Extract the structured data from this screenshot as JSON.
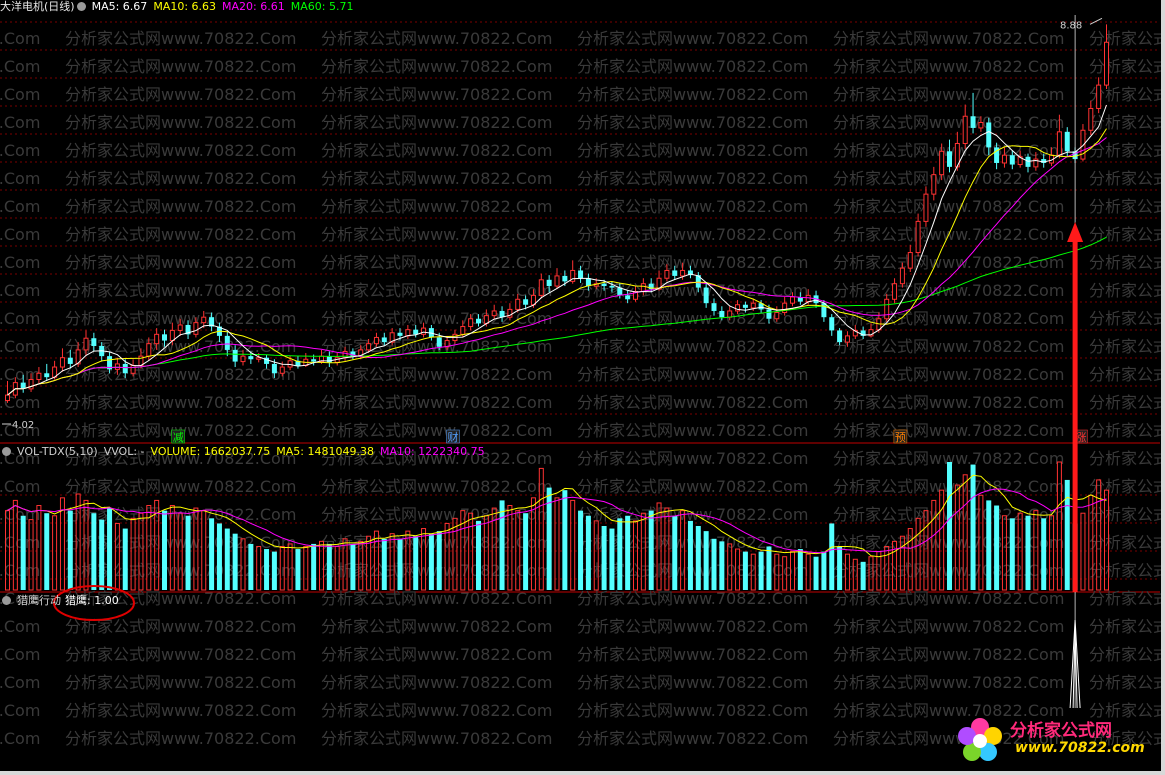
{
  "main_header": {
    "title": "大洋电机(日线)",
    "ma5": "MA5: 6.67",
    "ma10": "MA10: 6.63",
    "ma20": "MA20: 6.61",
    "ma60": "MA60: 5.71"
  },
  "vol_header": {
    "name": "VOL-TDX(5,10)",
    "vvol": "VVOL: -",
    "volume": "VOLUME: 1662037.75",
    "ma5": "MA5: 1481049.38",
    "ma10": "MA10: 1222340.75"
  },
  "ind_header": {
    "name": "猎鹰行动",
    "value": "猎鹰: 1.00"
  },
  "watermark": "分析家公式网www.70822.Com",
  "logo": {
    "brand": "分析家公式网",
    "url": "www.70822.com"
  },
  "colors": {
    "up": "#ff3232",
    "down": "#54ffff",
    "ma5": "#ffffff",
    "ma10": "#ffff00",
    "ma20": "#ff00ff",
    "ma60": "#00ff00",
    "grid": "#7a0000",
    "arrow": "#ff1a1a",
    "annotation_circle": "#e00000"
  },
  "chart_data": {
    "type": "candlestick",
    "price_labels": {
      "high": "8.88",
      "low": "4.02"
    },
    "price_range": [
      3.8,
      9.0
    ],
    "events": [
      {
        "label": "减",
        "bar": 22,
        "color": "#00ff00"
      },
      {
        "label": "财",
        "bar": 57,
        "color": "#54a0ff"
      },
      {
        "label": "预",
        "bar": 114,
        "color": "#ff8000"
      },
      {
        "label": "涨",
        "bar": 137,
        "color": "#ff3232"
      }
    ],
    "candles": [
      [
        4.05,
        4.12,
        4.3,
        4.02
      ],
      [
        4.12,
        4.28,
        4.35,
        4.08
      ],
      [
        4.28,
        4.2,
        4.38,
        4.15
      ],
      [
        4.2,
        4.32,
        4.4,
        4.16
      ],
      [
        4.32,
        4.4,
        4.48,
        4.26
      ],
      [
        4.4,
        4.35,
        4.52,
        4.3
      ],
      [
        4.35,
        4.48,
        4.56,
        4.32
      ],
      [
        4.48,
        4.6,
        4.72,
        4.42
      ],
      [
        4.6,
        4.52,
        4.7,
        4.46
      ],
      [
        4.52,
        4.7,
        4.8,
        4.48
      ],
      [
        4.7,
        4.85,
        4.95,
        4.62
      ],
      [
        4.85,
        4.75,
        4.92,
        4.68
      ],
      [
        4.75,
        4.62,
        4.8,
        4.55
      ],
      [
        4.62,
        4.45,
        4.68,
        4.4
      ],
      [
        4.45,
        4.52,
        4.6,
        4.38
      ],
      [
        4.52,
        4.4,
        4.58,
        4.34
      ],
      [
        4.4,
        4.5,
        4.58,
        4.36
      ],
      [
        4.5,
        4.62,
        4.72,
        4.46
      ],
      [
        4.62,
        4.78,
        4.86,
        4.56
      ],
      [
        4.78,
        4.9,
        4.98,
        4.7
      ],
      [
        4.9,
        4.82,
        4.96,
        4.74
      ],
      [
        4.82,
        4.95,
        5.05,
        4.76
      ],
      [
        4.95,
        5.02,
        5.1,
        4.88
      ],
      [
        5.02,
        4.9,
        5.08,
        4.84
      ],
      [
        4.9,
        5.05,
        5.12,
        4.86
      ],
      [
        5.05,
        5.12,
        5.2,
        4.98
      ],
      [
        5.12,
        5.0,
        5.18,
        4.94
      ],
      [
        5.0,
        4.88,
        5.05,
        4.8
      ],
      [
        4.88,
        4.7,
        4.94,
        4.62
      ],
      [
        4.7,
        4.55,
        4.76,
        4.48
      ],
      [
        4.55,
        4.62,
        4.7,
        4.5
      ],
      [
        4.62,
        4.58,
        4.68,
        4.52
      ],
      [
        4.58,
        4.6,
        4.66,
        4.54
      ],
      [
        4.6,
        4.52,
        4.64,
        4.46
      ],
      [
        4.52,
        4.4,
        4.58,
        4.34
      ],
      [
        4.4,
        4.48,
        4.55,
        4.36
      ],
      [
        4.48,
        4.56,
        4.62,
        4.44
      ],
      [
        4.56,
        4.5,
        4.62,
        4.46
      ],
      [
        4.5,
        4.58,
        4.66,
        4.48
      ],
      [
        4.58,
        4.55,
        4.64,
        4.5
      ],
      [
        4.55,
        4.62,
        4.7,
        4.52
      ],
      [
        4.62,
        4.54,
        4.68,
        4.48
      ],
      [
        4.54,
        4.6,
        4.66,
        4.5
      ],
      [
        4.6,
        4.68,
        4.74,
        4.56
      ],
      [
        4.68,
        4.62,
        4.72,
        4.58
      ],
      [
        4.62,
        4.7,
        4.76,
        4.58
      ],
      [
        4.7,
        4.78,
        4.84,
        4.66
      ],
      [
        4.78,
        4.86,
        4.92,
        4.74
      ],
      [
        4.86,
        4.8,
        4.92,
        4.76
      ],
      [
        4.8,
        4.92,
        4.98,
        4.76
      ],
      [
        4.92,
        4.88,
        4.98,
        4.82
      ],
      [
        4.88,
        4.96,
        5.02,
        4.84
      ],
      [
        4.96,
        4.9,
        5.02,
        4.86
      ],
      [
        4.9,
        4.98,
        5.05,
        4.86
      ],
      [
        4.98,
        4.86,
        5.02,
        4.82
      ],
      [
        4.86,
        4.74,
        4.92,
        4.7
      ],
      [
        4.74,
        4.82,
        4.88,
        4.7
      ],
      [
        4.82,
        4.9,
        4.96,
        4.78
      ],
      [
        4.9,
        5.0,
        5.08,
        4.86
      ],
      [
        5.0,
        5.1,
        5.16,
        4.95
      ],
      [
        5.1,
        5.04,
        5.16,
        5.0
      ],
      [
        5.04,
        5.14,
        5.22,
        5.0
      ],
      [
        5.14,
        5.2,
        5.28,
        5.1
      ],
      [
        5.2,
        5.12,
        5.26,
        5.06
      ],
      [
        5.12,
        5.22,
        5.3,
        5.08
      ],
      [
        5.22,
        5.35,
        5.42,
        5.18
      ],
      [
        5.35,
        5.28,
        5.4,
        5.22
      ],
      [
        5.28,
        5.4,
        5.48,
        5.24
      ],
      [
        5.4,
        5.6,
        5.68,
        5.36
      ],
      [
        5.6,
        5.52,
        5.66,
        5.44
      ],
      [
        5.52,
        5.65,
        5.75,
        5.48
      ],
      [
        5.65,
        5.58,
        5.72,
        5.52
      ],
      [
        5.58,
        5.72,
        5.85,
        5.55
      ],
      [
        5.72,
        5.62,
        5.78,
        5.56
      ],
      [
        5.62,
        5.52,
        5.68,
        5.46
      ],
      [
        5.52,
        5.55,
        5.62,
        5.48
      ],
      [
        5.55,
        5.52,
        5.6,
        5.46
      ],
      [
        5.52,
        5.5,
        5.58,
        5.44
      ],
      [
        5.5,
        5.4,
        5.56,
        5.36
      ],
      [
        5.4,
        5.35,
        5.46,
        5.3
      ],
      [
        5.35,
        5.45,
        5.52,
        5.32
      ],
      [
        5.45,
        5.55,
        5.62,
        5.4
      ],
      [
        5.55,
        5.48,
        5.62,
        5.44
      ],
      [
        5.48,
        5.62,
        5.72,
        5.46
      ],
      [
        5.62,
        5.72,
        5.8,
        5.58
      ],
      [
        5.72,
        5.65,
        5.78,
        5.6
      ],
      [
        5.65,
        5.72,
        5.82,
        5.6
      ],
      [
        5.72,
        5.66,
        5.78,
        5.62
      ],
      [
        5.66,
        5.5,
        5.7,
        5.44
      ],
      [
        5.5,
        5.3,
        5.56,
        5.24
      ],
      [
        5.3,
        5.2,
        5.36,
        5.14
      ],
      [
        5.2,
        5.12,
        5.26,
        5.08
      ],
      [
        5.12,
        5.2,
        5.26,
        5.08
      ],
      [
        5.2,
        5.28,
        5.34,
        5.16
      ],
      [
        5.28,
        5.24,
        5.32,
        5.18
      ],
      [
        5.24,
        5.3,
        5.36,
        5.2
      ],
      [
        5.3,
        5.22,
        5.34,
        5.18
      ],
      [
        5.22,
        5.1,
        5.28,
        5.04
      ],
      [
        5.1,
        5.18,
        5.26,
        5.06
      ],
      [
        5.18,
        5.3,
        5.38,
        5.14
      ],
      [
        5.3,
        5.38,
        5.44,
        5.26
      ],
      [
        5.38,
        5.32,
        5.44,
        5.28
      ],
      [
        5.32,
        5.4,
        5.48,
        5.28
      ],
      [
        5.4,
        5.3,
        5.46,
        5.24
      ],
      [
        5.3,
        5.12,
        5.34,
        5.06
      ],
      [
        5.12,
        4.95,
        5.16,
        4.88
      ],
      [
        4.95,
        4.8,
        4.98,
        4.76
      ],
      [
        4.8,
        4.88,
        4.94,
        4.74
      ],
      [
        4.88,
        4.95,
        5.02,
        4.84
      ],
      [
        4.95,
        4.88,
        5.0,
        4.84
      ],
      [
        4.88,
        4.96,
        5.04,
        4.86
      ],
      [
        4.96,
        5.1,
        5.18,
        4.92
      ],
      [
        5.1,
        5.35,
        5.42,
        5.06
      ],
      [
        5.35,
        5.55,
        5.62,
        5.3
      ],
      [
        5.55,
        5.75,
        5.82,
        5.5
      ],
      [
        5.75,
        5.95,
        6.05,
        5.7
      ],
      [
        5.95,
        6.35,
        6.45,
        5.9
      ],
      [
        6.35,
        6.7,
        6.8,
        6.28
      ],
      [
        6.7,
        6.95,
        7.05,
        6.62
      ],
      [
        6.95,
        7.25,
        7.35,
        6.88
      ],
      [
        7.25,
        7.05,
        7.4,
        6.98
      ],
      [
        7.05,
        7.35,
        7.5,
        7.0
      ],
      [
        7.35,
        7.7,
        7.85,
        7.28
      ],
      [
        7.7,
        7.55,
        8.0,
        7.48
      ],
      [
        7.55,
        7.62,
        7.7,
        7.5
      ],
      [
        7.62,
        7.3,
        7.68,
        7.2
      ],
      [
        7.3,
        7.1,
        7.36,
        7.02
      ],
      [
        7.1,
        7.2,
        7.3,
        7.04
      ],
      [
        7.2,
        7.08,
        7.26,
        7.02
      ],
      [
        7.08,
        7.18,
        7.26,
        7.04
      ],
      [
        7.18,
        7.05,
        7.22,
        6.98
      ],
      [
        7.05,
        7.15,
        7.24,
        7.0
      ],
      [
        7.15,
        7.1,
        7.22,
        7.04
      ],
      [
        7.1,
        7.2,
        7.3,
        7.06
      ],
      [
        7.2,
        7.5,
        7.72,
        7.16
      ],
      [
        7.5,
        7.25,
        7.56,
        7.18
      ],
      [
        7.25,
        7.15,
        7.3,
        7.1
      ],
      [
        7.15,
        7.52,
        7.6,
        7.12
      ],
      [
        7.52,
        7.8,
        7.9,
        7.46
      ],
      [
        7.8,
        8.1,
        8.2,
        7.74
      ],
      [
        8.1,
        8.65,
        8.88,
        8.05
      ]
    ],
    "volumes": [
      0.62,
      0.7,
      0.58,
      0.55,
      0.66,
      0.6,
      0.58,
      0.72,
      0.62,
      0.75,
      0.7,
      0.6,
      0.55,
      0.64,
      0.52,
      0.48,
      0.56,
      0.6,
      0.66,
      0.7,
      0.62,
      0.66,
      0.6,
      0.58,
      0.64,
      0.62,
      0.56,
      0.52,
      0.48,
      0.44,
      0.4,
      0.36,
      0.34,
      0.32,
      0.3,
      0.34,
      0.36,
      0.32,
      0.34,
      0.36,
      0.38,
      0.36,
      0.34,
      0.4,
      0.36,
      0.38,
      0.42,
      0.46,
      0.4,
      0.44,
      0.4,
      0.46,
      0.42,
      0.48,
      0.44,
      0.46,
      0.52,
      0.56,
      0.62,
      0.6,
      0.54,
      0.58,
      0.64,
      0.7,
      0.66,
      0.62,
      0.6,
      0.72,
      0.95,
      0.8,
      0.72,
      0.78,
      0.7,
      0.62,
      0.58,
      0.54,
      0.5,
      0.48,
      0.56,
      0.58,
      0.54,
      0.6,
      0.62,
      0.68,
      0.64,
      0.58,
      0.62,
      0.54,
      0.5,
      0.46,
      0.4,
      0.38,
      0.36,
      0.32,
      0.3,
      0.28,
      0.3,
      0.34,
      0.28,
      0.26,
      0.3,
      0.32,
      0.28,
      0.26,
      0.3,
      0.52,
      0.34,
      0.28,
      0.24,
      0.22,
      0.26,
      0.3,
      0.34,
      0.38,
      0.42,
      0.48,
      0.56,
      0.62,
      0.7,
      0.78,
      1.0,
      0.82,
      0.9,
      0.98,
      0.74,
      0.7,
      0.66,
      0.58,
      0.56,
      0.6,
      0.58,
      0.62,
      0.56,
      0.58,
      1.0,
      0.86,
      0.52,
      0.6,
      0.74,
      0.86,
      0.78
    ],
    "indicator": {
      "signal_bar": 136,
      "value": 1.0
    }
  }
}
